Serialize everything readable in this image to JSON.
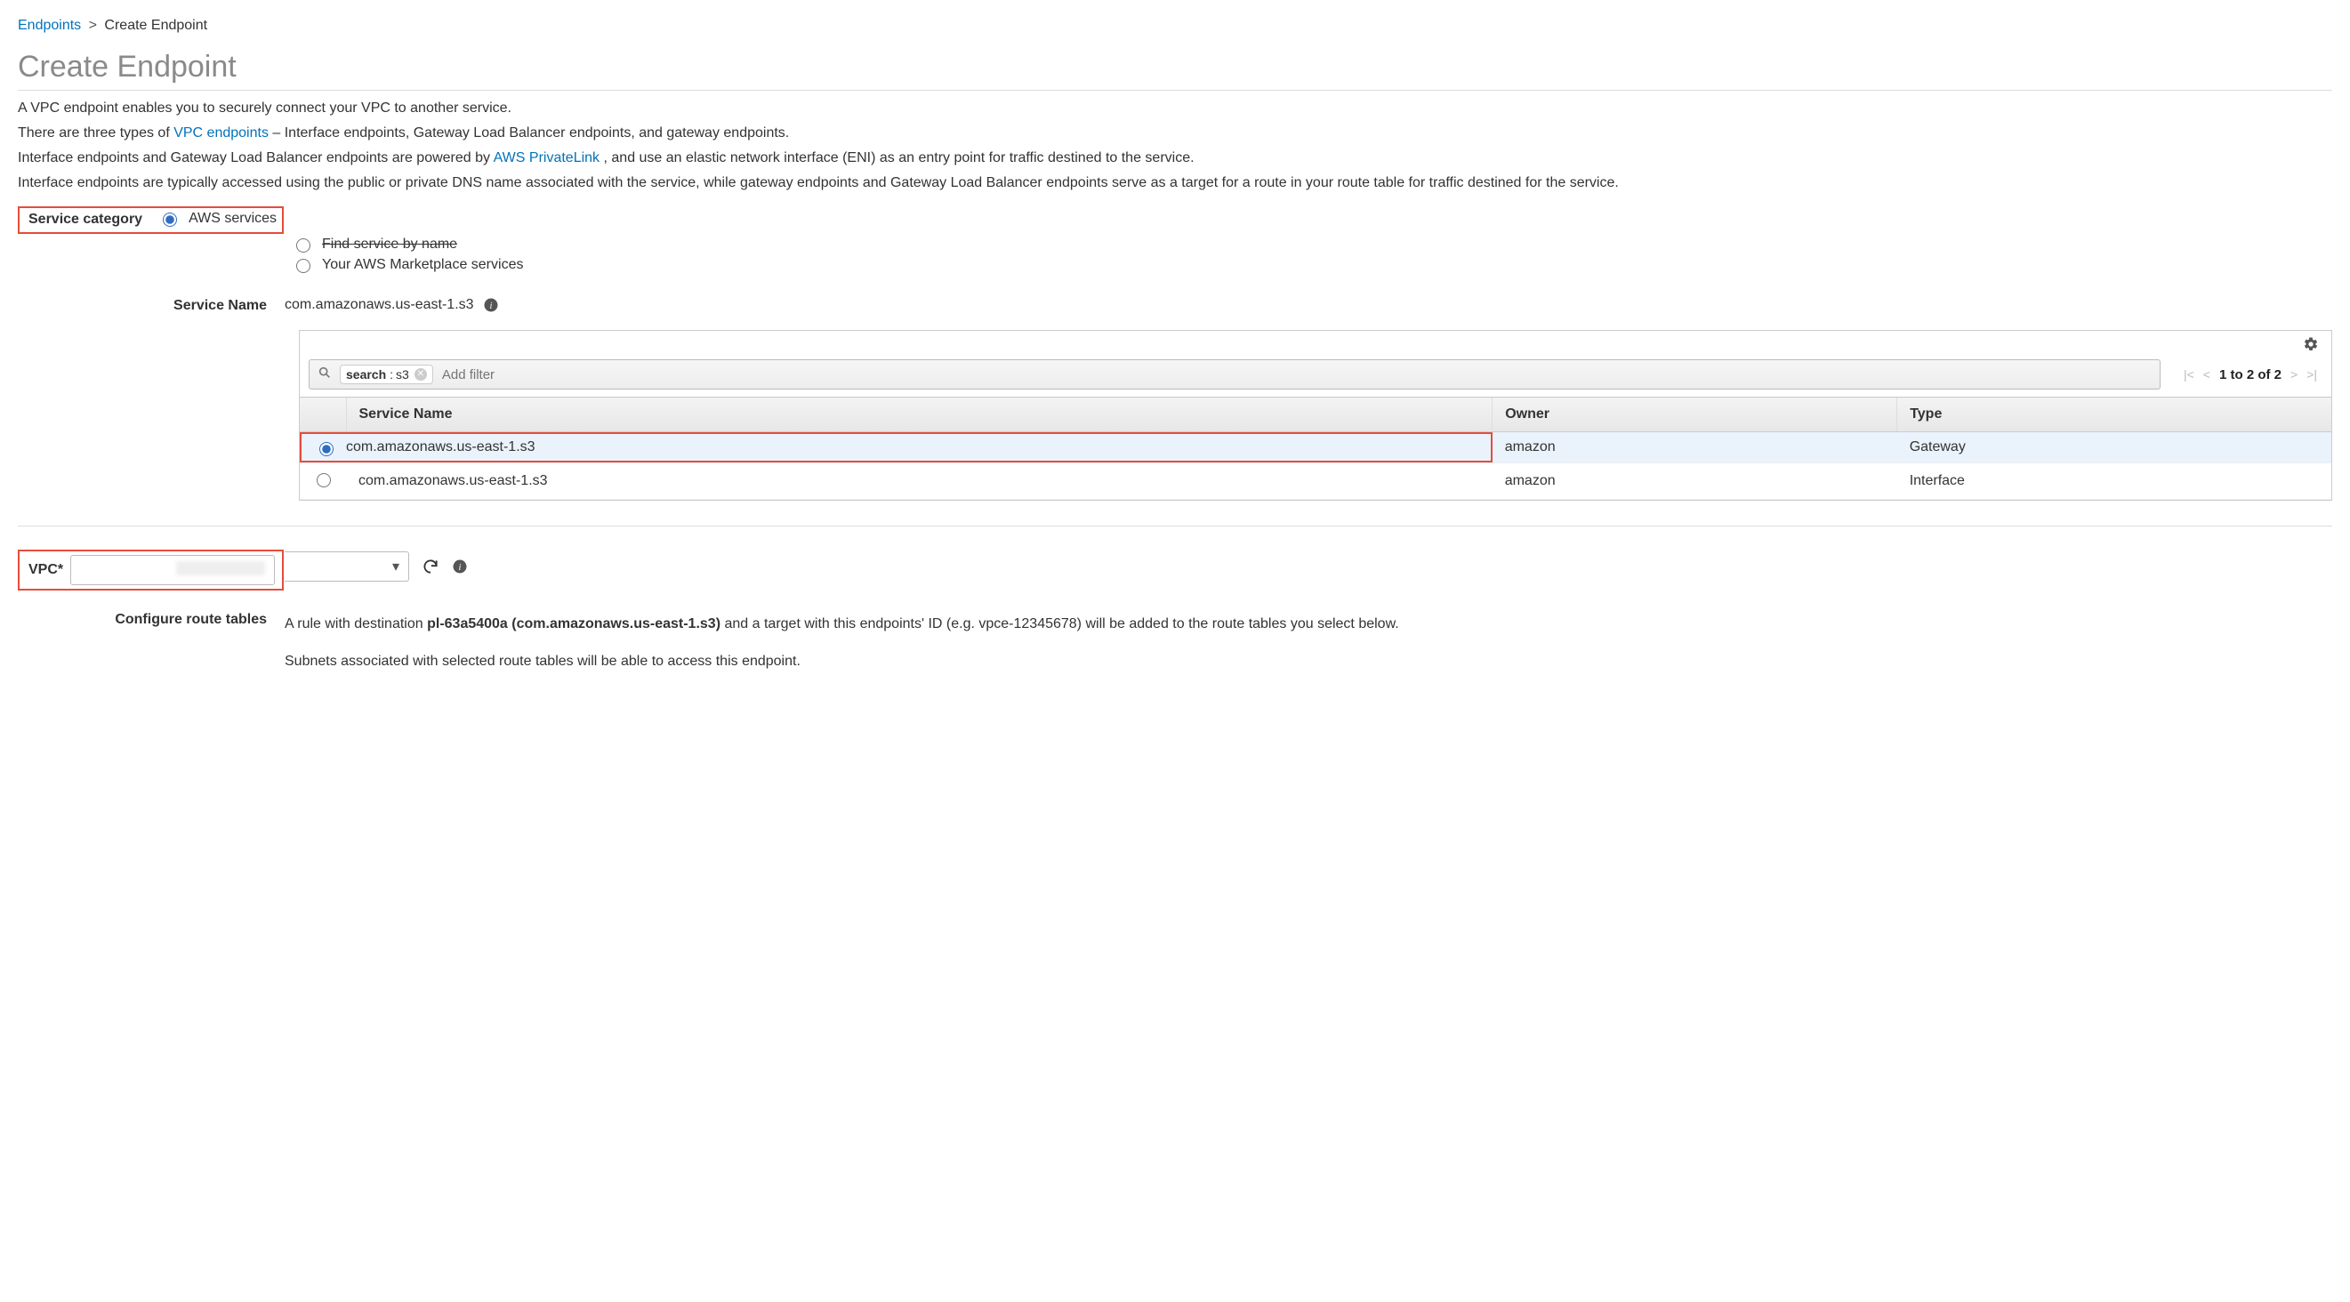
{
  "breadcrumb": {
    "parent": "Endpoints",
    "current": "Create Endpoint"
  },
  "title": "Create Endpoint",
  "intro": {
    "line1": "A VPC endpoint enables you to securely connect your VPC to another service.",
    "line2_pre": "There are three types of ",
    "line2_link": "VPC endpoints",
    "line2_post": " – Interface endpoints, Gateway Load Balancer endpoints, and gateway endpoints.",
    "line3_pre": "Interface endpoints and Gateway Load Balancer endpoints are powered by ",
    "line3_link": "AWS PrivateLink",
    "line3_post": ", and use an elastic network interface (ENI) as an entry point for traffic destined to the service.",
    "line4": "Interface endpoints are typically accessed using the public or private DNS name associated with the service, while gateway endpoints and Gateway Load Balancer endpoints serve as a target for a route in your route table for traffic destined for the service."
  },
  "service_category": {
    "label": "Service category",
    "options": {
      "aws": "AWS services",
      "byname": "Find service by name",
      "marketplace": "Your AWS Marketplace services"
    }
  },
  "service_name": {
    "label": "Service Name",
    "value": "com.amazonaws.us-east-1.s3"
  },
  "filter": {
    "chip_key": "search",
    "chip_val": "s3",
    "placeholder": "Add filter"
  },
  "pager": {
    "text": "1 to 2 of 2"
  },
  "table": {
    "headers": {
      "name": "Service Name",
      "owner": "Owner",
      "type": "Type"
    },
    "rows": [
      {
        "name": "com.amazonaws.us-east-1.s3",
        "owner": "amazon",
        "type": "Gateway",
        "selected": true
      },
      {
        "name": "com.amazonaws.us-east-1.s3",
        "owner": "amazon",
        "type": "Interface",
        "selected": false
      }
    ]
  },
  "vpc": {
    "label": "VPC*"
  },
  "route": {
    "label": "Configure route tables",
    "p1_pre": "A rule with destination ",
    "p1_bold": "pl-63a5400a (com.amazonaws.us-east-1.s3)",
    "p1_post": " and a target with this endpoints' ID (e.g. vpce-12345678) will be added to the route tables you select below.",
    "p2": "Subnets associated with selected route tables will be able to access this endpoint."
  }
}
